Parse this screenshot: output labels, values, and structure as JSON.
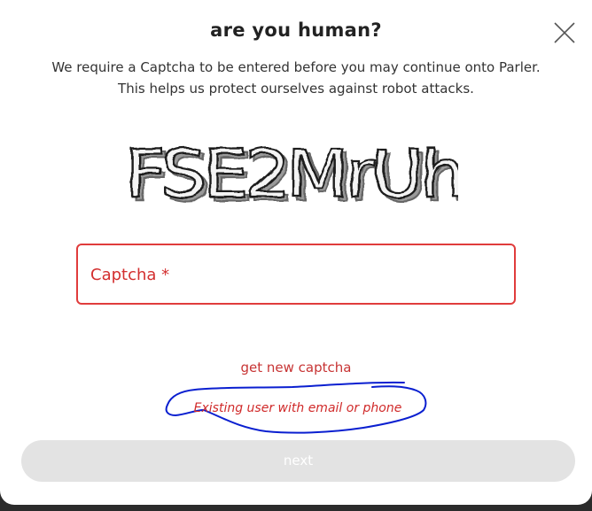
{
  "dialog": {
    "title": "are you human?",
    "description_line1": "We require a Captcha to be entered before you may continue onto Parler.",
    "description_line2": "This helps us protect ourselves against robot attacks.",
    "close_icon": "close-icon"
  },
  "captcha": {
    "image_text": "FSE2MrUh",
    "field_label": "Captcha *",
    "field_value": ""
  },
  "links": {
    "new_captcha": "get new captcha",
    "existing_user": "Existing user with email or phone"
  },
  "actions": {
    "next_label": "next"
  },
  "colors": {
    "accent_red": "#e03c3c",
    "link_red": "#c73434",
    "annotation_blue": "#0a1fd0",
    "disabled_button": "#e3e3e3"
  }
}
